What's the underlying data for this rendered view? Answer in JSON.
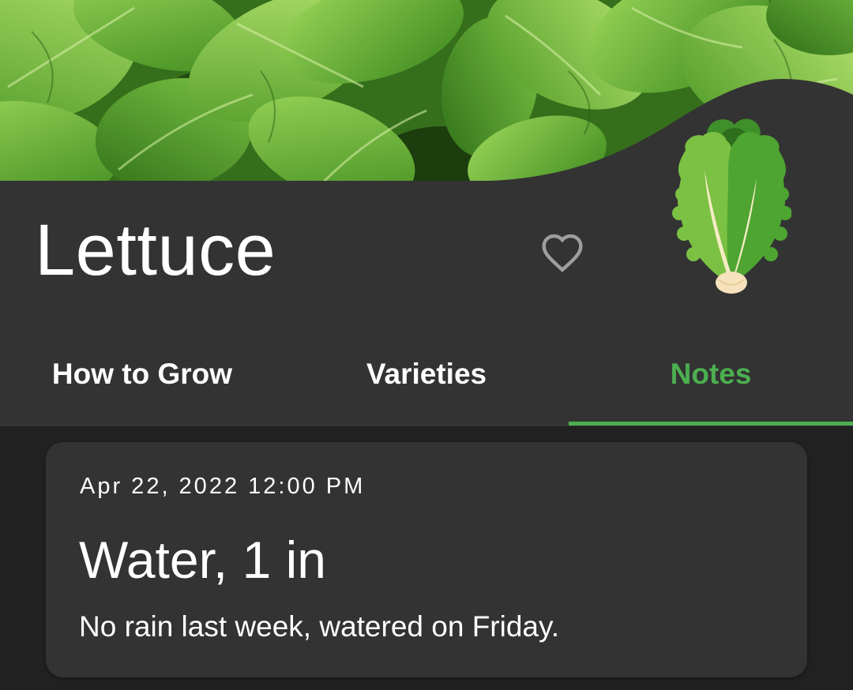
{
  "hero": {
    "image": "lettuce-leaves-photo"
  },
  "header": {
    "title": "Lettuce",
    "favorite_icon": "heart-outline-icon",
    "crop_icon": "lettuce-icon"
  },
  "tabs": [
    {
      "label": "How to Grow",
      "active": false
    },
    {
      "label": "Varieties",
      "active": false
    },
    {
      "label": "Notes",
      "active": true
    }
  ],
  "notes": [
    {
      "date": "Apr 22, 2022 12:00 PM",
      "title": "Water, 1 in",
      "body": "No rain last week, watered on Friday."
    }
  ],
  "colors": {
    "background": "#212121",
    "panel": "#333333",
    "accent": "#4caf50",
    "text": "#ffffff",
    "icon_muted": "#9e9e9e"
  }
}
